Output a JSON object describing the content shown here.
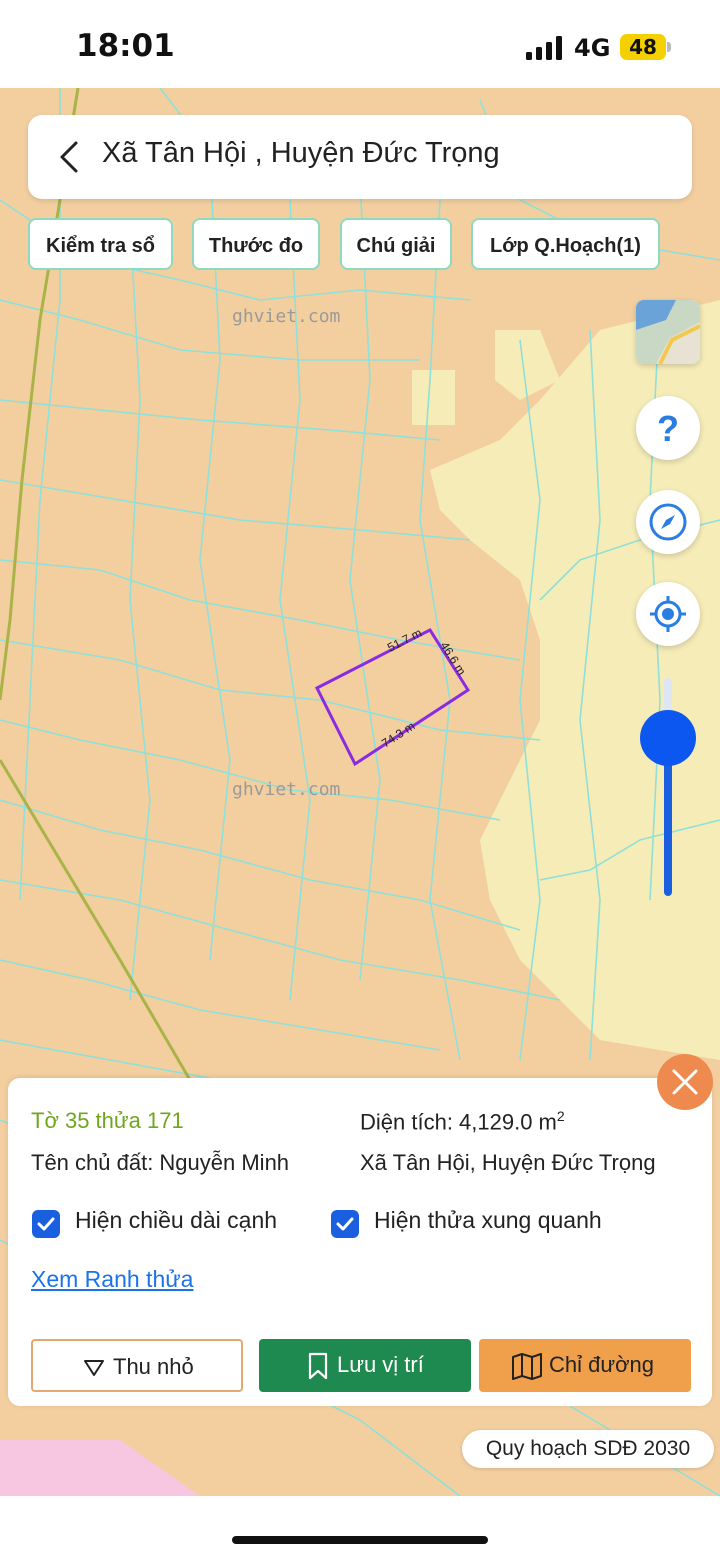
{
  "status": {
    "time": "18:01",
    "network": "4G",
    "battery": "48"
  },
  "header": {
    "title": "Xã Tân Hội , Huyện Đức Trọng",
    "back_icon": "chevron-left-icon"
  },
  "chips": [
    "Kiểm tra sổ",
    "Thước đo",
    "Chú giải",
    "Lớp Q.Hoạch(1)"
  ],
  "map": {
    "watermark": "ghviet.com",
    "watermark_edge": "ghviet.com",
    "parcel_edges": [
      "51.7 m",
      "46.6 m",
      "74.3 m"
    ],
    "colors": {
      "land_orange": "#f3cfa0",
      "land_yellow": "#f6ecb8",
      "parcel_lines": "#8fe0d8",
      "selected_parcel": "#8a2be2"
    },
    "zoom_level": 0.72
  },
  "map_controls": {
    "layers": "map-layers-icon",
    "help": "help-icon",
    "compass": "compass-icon",
    "locate": "locate-icon"
  },
  "info": {
    "parcel": "Tờ 35 thửa 171",
    "area_label": "Diện tích: 4,129.0 m",
    "area_sup": "2",
    "owner": "Tên chủ đất: Nguyễn Minh",
    "location": "Xã Tân Hội, Huyện Đức Trọng",
    "show_edge_lengths": "Hiện chiều dài cạnh",
    "show_neighbors": "Hiện thửa xung quanh",
    "view_boundary": "Xem Ranh thửa"
  },
  "buttons": {
    "shrink": "Thu nhỏ",
    "save": "Lưu vị trí",
    "route": "Chỉ đường"
  },
  "plan_label": "Quy hoạch SDĐ 2030"
}
